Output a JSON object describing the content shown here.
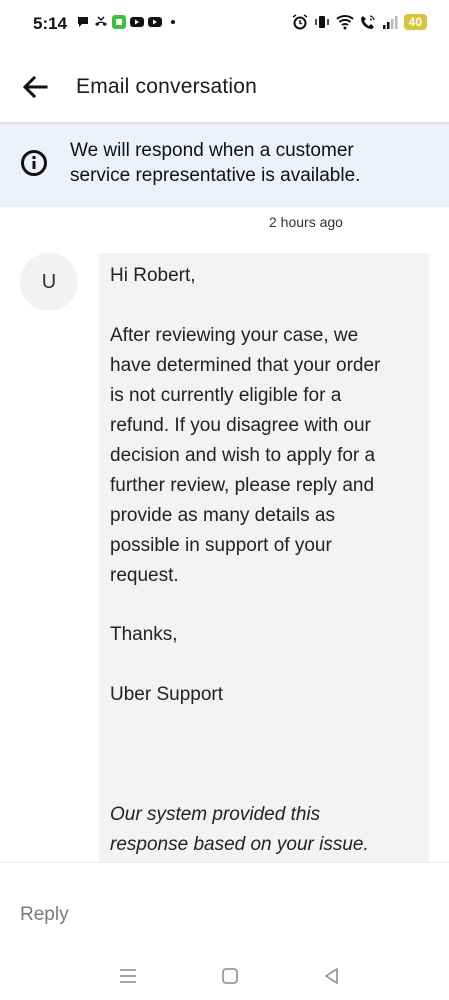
{
  "status_bar": {
    "time": "5:14",
    "battery": "40",
    "battery_color": "#d6c43a"
  },
  "header": {
    "title": "Email conversation",
    "back_icon": "arrow-left-icon"
  },
  "banner": {
    "icon": "info-icon",
    "text_line1": "We will respond when a customer",
    "text_line2": "service representative is available.",
    "background": "#eef1fb"
  },
  "conversation": {
    "timestamp": "2 hours ago",
    "avatar_letter": "U",
    "message": {
      "greeting": "Hi Robert,",
      "body_lines": [
        "After reviewing your case, we",
        "have determined that your order",
        "is not currently eligible for a",
        "refund. If you disagree with our",
        "decision and wish to apply for a",
        "further review, please reply and",
        "provide as many details as",
        "possible in support of your",
        "request."
      ],
      "closing": "Thanks,",
      "signature": "Uber Support",
      "footer_line1": "Our system provided this",
      "footer_line2": "response based on your issue."
    }
  },
  "reply": {
    "placeholder": "Reply"
  },
  "nav_bar": {
    "recents_icon": "recents-icon",
    "home_icon": "home-icon",
    "back_icon": "nav-back-icon"
  }
}
